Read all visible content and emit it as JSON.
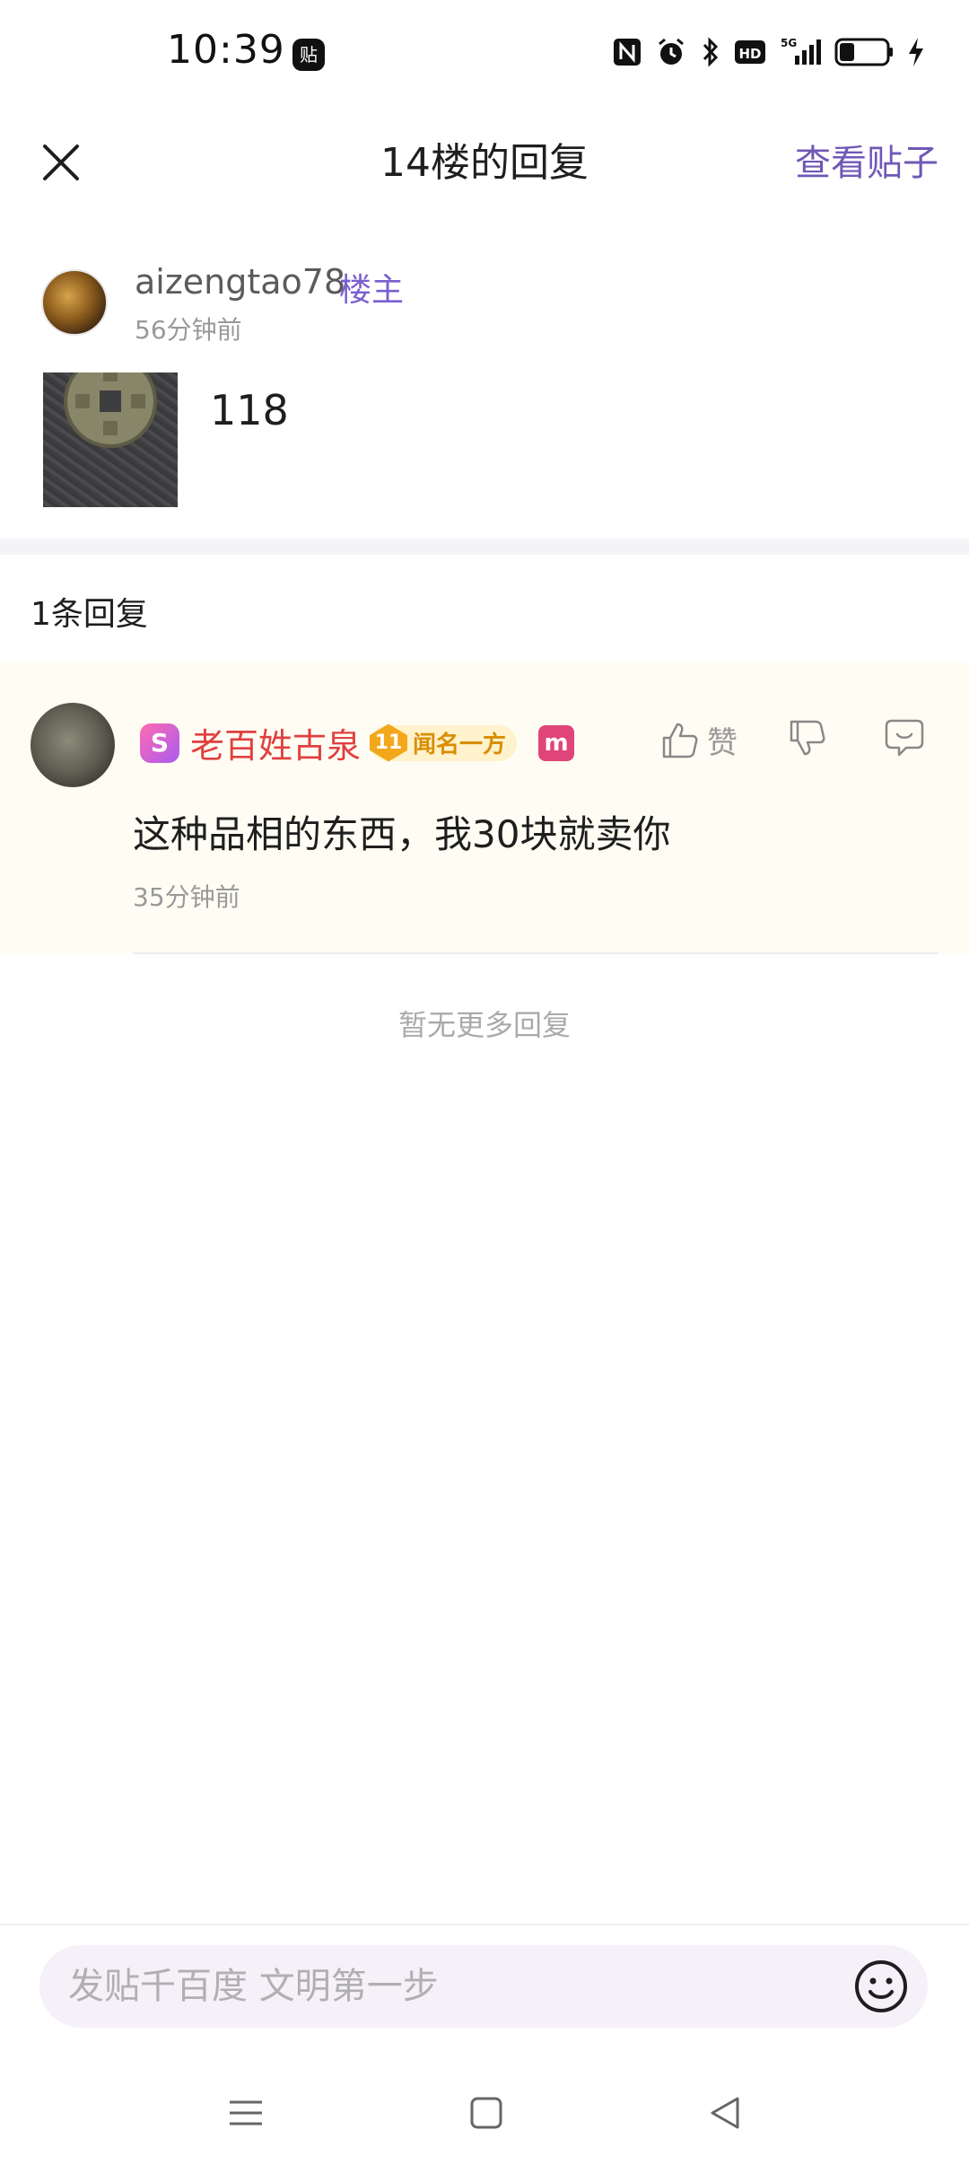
{
  "status_bar": {
    "time": "10:39",
    "app_icon": "贴",
    "icons": [
      "nfc-icon",
      "alarm-icon",
      "bluetooth-icon",
      "hd-icon",
      "5g-signal-icon",
      "battery-icon",
      "charging-icon"
    ],
    "network_label": "5G",
    "hd_label": "HD"
  },
  "header": {
    "title": "14楼的回复",
    "view_post_label": "查看贴子"
  },
  "floor": {
    "username": "aizengtao78",
    "badge": "楼主",
    "time": "56分钟前",
    "content": "118"
  },
  "replies": {
    "count_label": "1条回复",
    "items": [
      {
        "s_badge": "S",
        "username": "老百姓古泉",
        "level": "11",
        "level_title": "闻名一方",
        "m_badge": "m",
        "like_label": "赞",
        "text": "这种品相的东西，我30块就卖你",
        "time": "35分钟前"
      }
    ],
    "no_more_label": "暂无更多回复"
  },
  "input": {
    "placeholder": "发贴千百度 文明第一步"
  },
  "colors": {
    "accent": "#6f58b6",
    "username_red": "#e04040",
    "reply_bg": "#fffdf3"
  }
}
